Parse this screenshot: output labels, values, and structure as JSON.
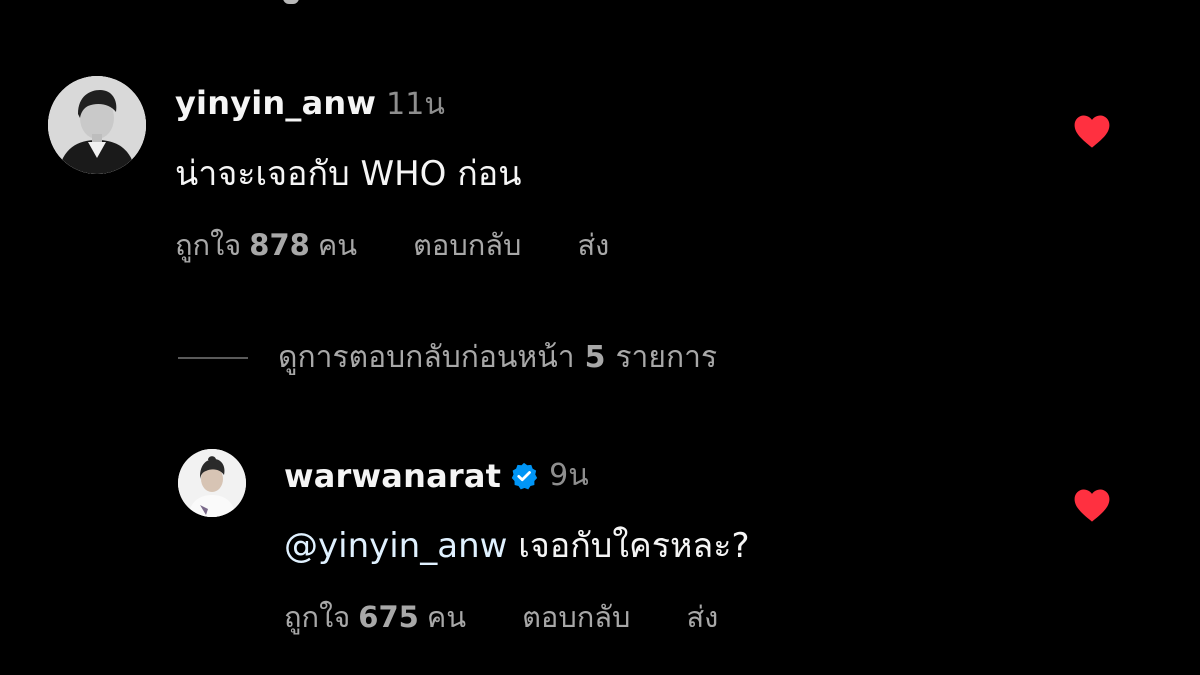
{
  "colors": {
    "background": "#000000",
    "text_primary": "#f5f5f5",
    "text_secondary": "#a8a8a8",
    "timestamp": "#8e8e8e",
    "heart": "#ff3040",
    "verified": "#0095f6"
  },
  "comments": [
    {
      "username": "yinyin_anw",
      "time": "11น",
      "text": "น่าจะเจอกับ WHO ก่อน",
      "likes_prefix": "ถูกใจ",
      "likes_count": "878",
      "likes_suffix": "คน",
      "reply_label": "ตอบกลับ",
      "send_label": "ส่ง",
      "liked": true,
      "avatar_icon": "profile-photo-avatar"
    },
    {
      "username": "warwanarat",
      "verified": true,
      "time": "9น",
      "mention": "@yinyin_anw",
      "text": "เจอกับใครหละ?",
      "likes_prefix": "ถูกใจ",
      "likes_count": "675",
      "likes_suffix": "คน",
      "reply_label": "ตอบกลับ",
      "send_label": "ส่ง",
      "liked": true,
      "avatar_icon": "profile-photo-avatar"
    }
  ],
  "view_replies": {
    "prefix": "ดูการตอบกลับก่อนหน้า",
    "count": "5",
    "suffix": "รายการ"
  }
}
